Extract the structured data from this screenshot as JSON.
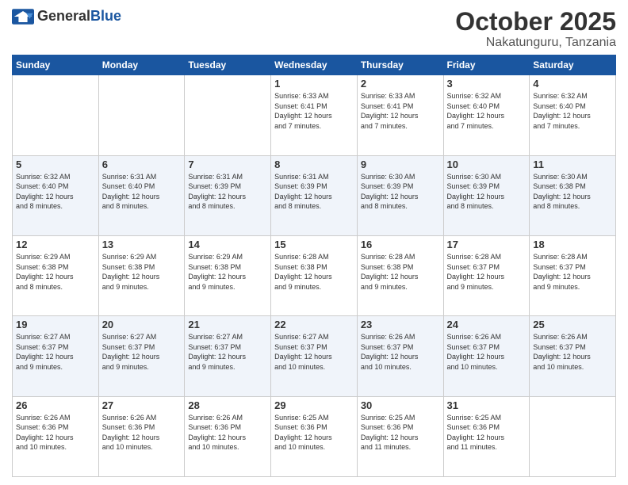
{
  "header": {
    "logo_general": "General",
    "logo_blue": "Blue",
    "month_title": "October 2025",
    "location": "Nakatunguru, Tanzania"
  },
  "weekdays": [
    "Sunday",
    "Monday",
    "Tuesday",
    "Wednesday",
    "Thursday",
    "Friday",
    "Saturday"
  ],
  "weeks": [
    [
      {
        "day": "",
        "info": ""
      },
      {
        "day": "",
        "info": ""
      },
      {
        "day": "",
        "info": ""
      },
      {
        "day": "1",
        "info": "Sunrise: 6:33 AM\nSunset: 6:41 PM\nDaylight: 12 hours\nand 7 minutes."
      },
      {
        "day": "2",
        "info": "Sunrise: 6:33 AM\nSunset: 6:41 PM\nDaylight: 12 hours\nand 7 minutes."
      },
      {
        "day": "3",
        "info": "Sunrise: 6:32 AM\nSunset: 6:40 PM\nDaylight: 12 hours\nand 7 minutes."
      },
      {
        "day": "4",
        "info": "Sunrise: 6:32 AM\nSunset: 6:40 PM\nDaylight: 12 hours\nand 7 minutes."
      }
    ],
    [
      {
        "day": "5",
        "info": "Sunrise: 6:32 AM\nSunset: 6:40 PM\nDaylight: 12 hours\nand 8 minutes."
      },
      {
        "day": "6",
        "info": "Sunrise: 6:31 AM\nSunset: 6:40 PM\nDaylight: 12 hours\nand 8 minutes."
      },
      {
        "day": "7",
        "info": "Sunrise: 6:31 AM\nSunset: 6:39 PM\nDaylight: 12 hours\nand 8 minutes."
      },
      {
        "day": "8",
        "info": "Sunrise: 6:31 AM\nSunset: 6:39 PM\nDaylight: 12 hours\nand 8 minutes."
      },
      {
        "day": "9",
        "info": "Sunrise: 6:30 AM\nSunset: 6:39 PM\nDaylight: 12 hours\nand 8 minutes."
      },
      {
        "day": "10",
        "info": "Sunrise: 6:30 AM\nSunset: 6:39 PM\nDaylight: 12 hours\nand 8 minutes."
      },
      {
        "day": "11",
        "info": "Sunrise: 6:30 AM\nSunset: 6:38 PM\nDaylight: 12 hours\nand 8 minutes."
      }
    ],
    [
      {
        "day": "12",
        "info": "Sunrise: 6:29 AM\nSunset: 6:38 PM\nDaylight: 12 hours\nand 8 minutes."
      },
      {
        "day": "13",
        "info": "Sunrise: 6:29 AM\nSunset: 6:38 PM\nDaylight: 12 hours\nand 9 minutes."
      },
      {
        "day": "14",
        "info": "Sunrise: 6:29 AM\nSunset: 6:38 PM\nDaylight: 12 hours\nand 9 minutes."
      },
      {
        "day": "15",
        "info": "Sunrise: 6:28 AM\nSunset: 6:38 PM\nDaylight: 12 hours\nand 9 minutes."
      },
      {
        "day": "16",
        "info": "Sunrise: 6:28 AM\nSunset: 6:38 PM\nDaylight: 12 hours\nand 9 minutes."
      },
      {
        "day": "17",
        "info": "Sunrise: 6:28 AM\nSunset: 6:37 PM\nDaylight: 12 hours\nand 9 minutes."
      },
      {
        "day": "18",
        "info": "Sunrise: 6:28 AM\nSunset: 6:37 PM\nDaylight: 12 hours\nand 9 minutes."
      }
    ],
    [
      {
        "day": "19",
        "info": "Sunrise: 6:27 AM\nSunset: 6:37 PM\nDaylight: 12 hours\nand 9 minutes."
      },
      {
        "day": "20",
        "info": "Sunrise: 6:27 AM\nSunset: 6:37 PM\nDaylight: 12 hours\nand 9 minutes."
      },
      {
        "day": "21",
        "info": "Sunrise: 6:27 AM\nSunset: 6:37 PM\nDaylight: 12 hours\nand 9 minutes."
      },
      {
        "day": "22",
        "info": "Sunrise: 6:27 AM\nSunset: 6:37 PM\nDaylight: 12 hours\nand 10 minutes."
      },
      {
        "day": "23",
        "info": "Sunrise: 6:26 AM\nSunset: 6:37 PM\nDaylight: 12 hours\nand 10 minutes."
      },
      {
        "day": "24",
        "info": "Sunrise: 6:26 AM\nSunset: 6:37 PM\nDaylight: 12 hours\nand 10 minutes."
      },
      {
        "day": "25",
        "info": "Sunrise: 6:26 AM\nSunset: 6:37 PM\nDaylight: 12 hours\nand 10 minutes."
      }
    ],
    [
      {
        "day": "26",
        "info": "Sunrise: 6:26 AM\nSunset: 6:36 PM\nDaylight: 12 hours\nand 10 minutes."
      },
      {
        "day": "27",
        "info": "Sunrise: 6:26 AM\nSunset: 6:36 PM\nDaylight: 12 hours\nand 10 minutes."
      },
      {
        "day": "28",
        "info": "Sunrise: 6:26 AM\nSunset: 6:36 PM\nDaylight: 12 hours\nand 10 minutes."
      },
      {
        "day": "29",
        "info": "Sunrise: 6:25 AM\nSunset: 6:36 PM\nDaylight: 12 hours\nand 10 minutes."
      },
      {
        "day": "30",
        "info": "Sunrise: 6:25 AM\nSunset: 6:36 PM\nDaylight: 12 hours\nand 11 minutes."
      },
      {
        "day": "31",
        "info": "Sunrise: 6:25 AM\nSunset: 6:36 PM\nDaylight: 12 hours\nand 11 minutes."
      },
      {
        "day": "",
        "info": ""
      }
    ]
  ]
}
